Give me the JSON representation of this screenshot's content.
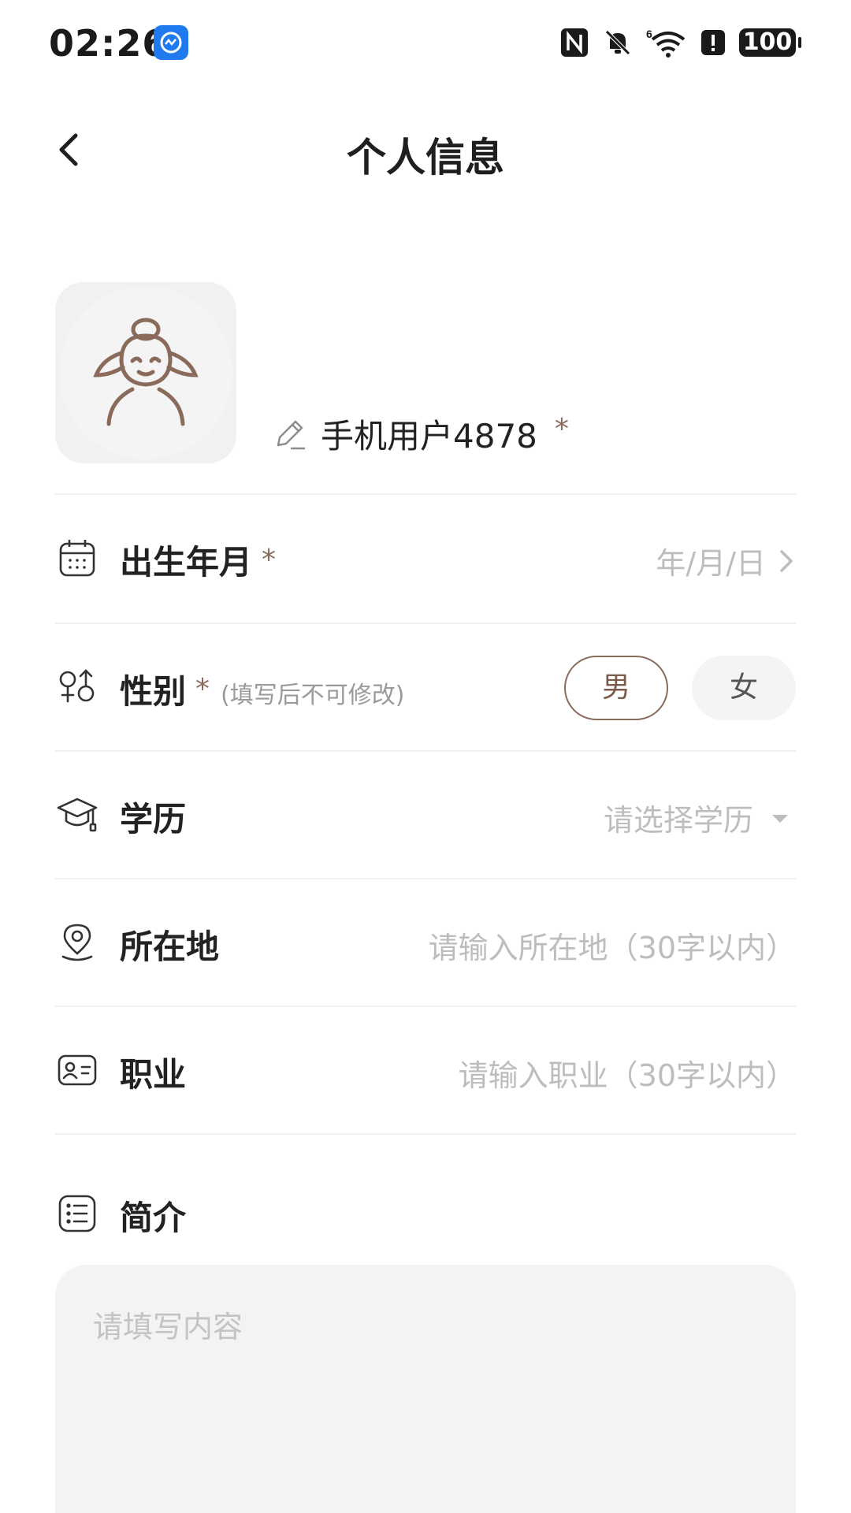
{
  "status_bar": {
    "time": "02:26",
    "battery": "100",
    "icons": [
      "app-notification-icon",
      "nfc-icon",
      "mute-bell-icon",
      "wifi-6-icon",
      "alert-icon",
      "battery-icon"
    ]
  },
  "nav": {
    "title": "个人信息",
    "back_icon": "chevron-left-icon"
  },
  "profile": {
    "name": "手机用户4878",
    "required_mark": "*",
    "avatar_icon": "default-avatar-icon",
    "edit_icon": "pencil-icon"
  },
  "fields": {
    "birth": {
      "label": "出生年月",
      "required_mark": "*",
      "value": "年/月/日",
      "icon": "calendar-icon"
    },
    "gender": {
      "label": "性别",
      "required_mark": "*",
      "note": "(填写后不可修改)",
      "options": [
        "男",
        "女"
      ],
      "selected": "男",
      "icon": "gender-icon"
    },
    "education": {
      "label": "学历",
      "placeholder": "请选择学历",
      "icon": "graduation-cap-icon"
    },
    "location": {
      "label": "所在地",
      "placeholder": "请输入所在地（30字以内）",
      "icon": "location-pin-icon"
    },
    "occupation": {
      "label": "职业",
      "placeholder": "请输入职业（30字以内）",
      "icon": "id-card-icon"
    },
    "intro": {
      "label": "简介",
      "placeholder": "请填写内容",
      "icon": "list-icon"
    }
  },
  "colors": {
    "accent_brown": "#8a6b5b",
    "placeholder_gray": "#bdbdbd",
    "input_bg": "#f3f3f3"
  }
}
